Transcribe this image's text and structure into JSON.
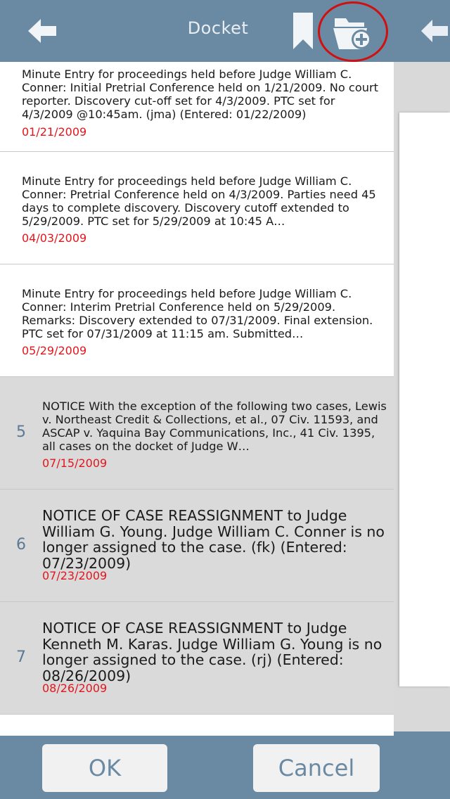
{
  "header": {
    "title": "Docket"
  },
  "entries": [
    {
      "number": "",
      "text": "Minute Entry for proceedings held before Judge William C. Conner: Initial Pretrial Conference held on 1/21/2009. No court reporter. Discovery cut-off set for 4/3/2009. PTC set for 4/3/2009 @10:45am. (jma) (Entered: 01/22/2009)",
      "date": "01/21/2009"
    },
    {
      "number": "",
      "text": "Minute Entry for proceedings held before Judge William C. Conner: Pretrial Conference held on 4/3/2009. Parties need 45 days to complete discovery. Discovery cutoff extended to 5/29/2009. PTC set for 5/29/2009 at 10:45 A…",
      "date": "04/03/2009"
    },
    {
      "number": "",
      "text": "Minute Entry for proceedings held before Judge William C. Conner: Interim Pretrial Conference held on 5/29/2009. Remarks: Discovery extended to 07/31/2009. Final extension. PTC set for 07/31/2009 at 11:15 am. Submitted…",
      "date": "05/29/2009"
    },
    {
      "number": "5",
      "text": "NOTICE With the exception of the following two cases, Lewis v. Northeast Credit & Collections, et al., 07 Civ. 11593, and ASCAP v. Yaquina Bay Communications, Inc., 41 Civ. 1395, all cases on the docket of Judge W…",
      "date": "07/15/2009"
    },
    {
      "number": "6",
      "text": "NOTICE OF CASE REASSIGNMENT to Judge William G. Young. Judge William C. Conner is no longer assigned to the case. (fk) (Entered: 07/23/2009)",
      "date": "07/23/2009"
    },
    {
      "number": "7",
      "text": "NOTICE OF CASE REASSIGNMENT to Judge Kenneth M. Karas. Judge William G. Young is no longer assigned to the case. (rj) (Entered: 08/26/2009)",
      "date": "08/26/2009"
    }
  ],
  "buttons": {
    "ok": "OK",
    "cancel": "Cancel"
  },
  "icons": {
    "back": "back-arrow-icon",
    "bookmark": "bookmark-icon",
    "folder_add": "folder-add-icon"
  },
  "colors": {
    "bar": "#6a8aa3",
    "date": "#e3161c",
    "highlight": "#d01010",
    "selected_row": "#dadada"
  }
}
